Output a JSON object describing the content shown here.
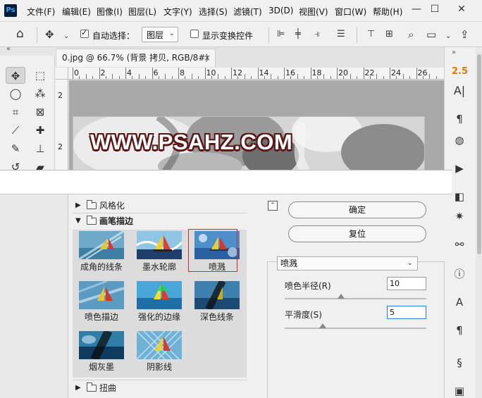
{
  "app": {
    "logo": "Ps"
  },
  "menu": [
    "文件(F)",
    "编辑(E)",
    "图像(I)",
    "图层(L)",
    "文字(Y)",
    "选择(S)",
    "滤镜(T)",
    "3D(D)",
    "视图(V)",
    "窗口(W)",
    "帮助(H)"
  ],
  "window_controls": {
    "minimize": "—",
    "maximize": "☐",
    "close": "✕"
  },
  "options_bar": {
    "auto_select_label": "自动选择：",
    "auto_select_checked": true,
    "auto_select_target": "图层",
    "show_transform_label": "显示变换控件",
    "show_transform_checked": false
  },
  "document": {
    "tab_title": "0.jpg @ 66.7% (背景 拷贝, RGB/8#) *",
    "tab_close": "×",
    "ruler_h": [
      "0",
      "2",
      "4",
      "6",
      "8",
      "10",
      "12",
      "14",
      "16",
      "18",
      "20",
      "22",
      "24",
      "26"
    ],
    "ruler_v": [
      "2",
      "2"
    ],
    "watermark": "WWW.PSAHZ.COM"
  },
  "right_panel": {
    "char_size": "2.5"
  },
  "filter_gallery": {
    "categories": [
      {
        "label": "风格化",
        "open": false
      },
      {
        "label": "画笔描边",
        "open": true
      },
      {
        "label": "扭曲",
        "open": false
      }
    ],
    "filters": [
      {
        "label": "成角的线条",
        "selected": false
      },
      {
        "label": "墨水轮廓",
        "selected": false
      },
      {
        "label": "喷溅",
        "selected": true
      },
      {
        "label": "喷色描边",
        "selected": false
      },
      {
        "label": "强化的边缘",
        "selected": false
      },
      {
        "label": "深色线条",
        "selected": false
      },
      {
        "label": "烟灰墨",
        "selected": false
      },
      {
        "label": "阴影线",
        "selected": false
      }
    ],
    "ok_label": "确定",
    "reset_label": "复位",
    "hide_toggle": "⌃",
    "current_filter": "喷溅",
    "params": [
      {
        "label": "喷色半径(R)",
        "value": "10",
        "slider_fraction": 0.4,
        "focused": false
      },
      {
        "label": "平滑度(S)",
        "value": "5",
        "slider_fraction": 0.27,
        "focused": true
      }
    ]
  },
  "colors": {
    "watermark_outline": "#5a1616",
    "selection_red": "#e0262a",
    "char_size_orange": "#e07b00"
  }
}
